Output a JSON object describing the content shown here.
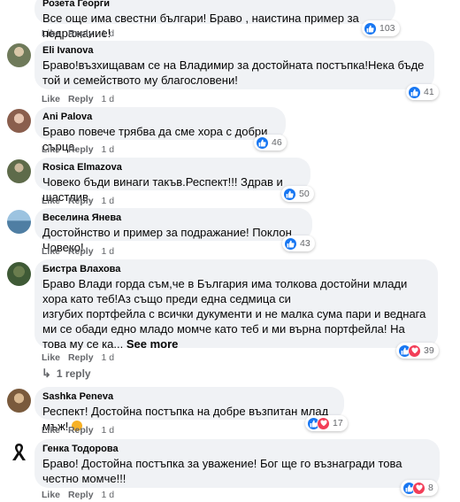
{
  "comments": [
    {
      "author": "Розета Георги",
      "text": "Все още има свестни българи! Браво , наистина пример за подражание!",
      "like": "Like",
      "reply": "Reply",
      "time": "1 d",
      "reaction_count": "103"
    },
    {
      "author": "Eli Ivanova",
      "text": "Браво!възхищавам се на Владимир за достойната постъпка!Нека бъде той и семейството му благословени!",
      "like": "Like",
      "reply": "Reply",
      "time": "1 d",
      "reaction_count": "41"
    },
    {
      "author": "Ani Palova",
      "text": "Браво повече трябва да сме хора с добри сърца.",
      "like": "Like",
      "reply": "Reply",
      "time": "1 d",
      "reaction_count": "46"
    },
    {
      "author": "Rosica Elmazova",
      "text": "Човеко бъди винаги такъв.Респект!!! Здрав и щастлив.",
      "like": "Like",
      "reply": "Reply",
      "time": "1 d",
      "reaction_count": "50"
    },
    {
      "author": "Веселина Янева",
      "text": "Достойнство и пример за подражание! Поклон Човеко!",
      "like": "Like",
      "reply": "Reply",
      "time": "1 d",
      "reaction_count": "43"
    },
    {
      "author": "Бистра Влахова",
      "text": "Браво Влади горда съм,че в България има толкова достойни млади хора като теб!Аз също преди една седмица си\nизгубих портфейла с всички дукументи и не малка сума пари и веднага ми се обади едно младо момче като теб и ми върна портфейла! На това му се ка... ",
      "see_more": "See more",
      "like": "Like",
      "reply": "Reply",
      "time": "1 d",
      "reaction_count": "39",
      "replies_link": "1 reply"
    },
    {
      "author": "Sashka Peneva",
      "text": "Респект! Достойна постъпка на добре възпитан млад мъж! ",
      "like": "Like",
      "reply": "Reply",
      "time": "1 d",
      "reaction_count": "17"
    },
    {
      "author": "Генка Тодорова",
      "text": "Браво! Достойна постъпка за уважение! Бог ще го възнагради това честно момче!!!",
      "like": "Like",
      "reply": "Reply",
      "time": "1 d",
      "reaction_count": "8"
    }
  ],
  "colors": {
    "bubble": "#f0f2f5",
    "like_blue": "#1877f2",
    "love_red": "#f33e58",
    "care_yellow": "#f7b125",
    "meta_grey": "#65676b"
  },
  "icons": {
    "like": "thumbs-up-icon",
    "love": "heart-icon",
    "care": "clapping-hands-icon",
    "reply_arrow": "reply-arrow-icon",
    "mourning": "black-ribbon-icon"
  }
}
